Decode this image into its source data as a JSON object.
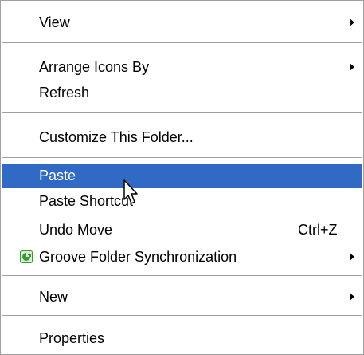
{
  "menu": {
    "items": {
      "view": {
        "label": "View",
        "has_submenu": true
      },
      "arrange_icons": {
        "label": "Arrange Icons By",
        "has_submenu": true
      },
      "refresh": {
        "label": "Refresh"
      },
      "customize": {
        "label": "Customize This Folder..."
      },
      "paste": {
        "label": "Paste",
        "highlighted": true
      },
      "paste_shortcut": {
        "label": "Paste Shortcut"
      },
      "undo_move": {
        "label": "Undo Move",
        "shortcut": "Ctrl+Z"
      },
      "groove": {
        "label": "Groove Folder Synchronization",
        "icon": "groove-icon",
        "has_submenu": true
      },
      "new": {
        "label": "New",
        "has_submenu": true
      },
      "properties": {
        "label": "Properties"
      }
    }
  },
  "colors": {
    "highlight": "#316ac5",
    "highlight_text": "#ffffff",
    "separator": "#a0a0a0",
    "groove_green": "#3a9a3a"
  },
  "cursor": {
    "icon": "hand-pointer-icon"
  }
}
